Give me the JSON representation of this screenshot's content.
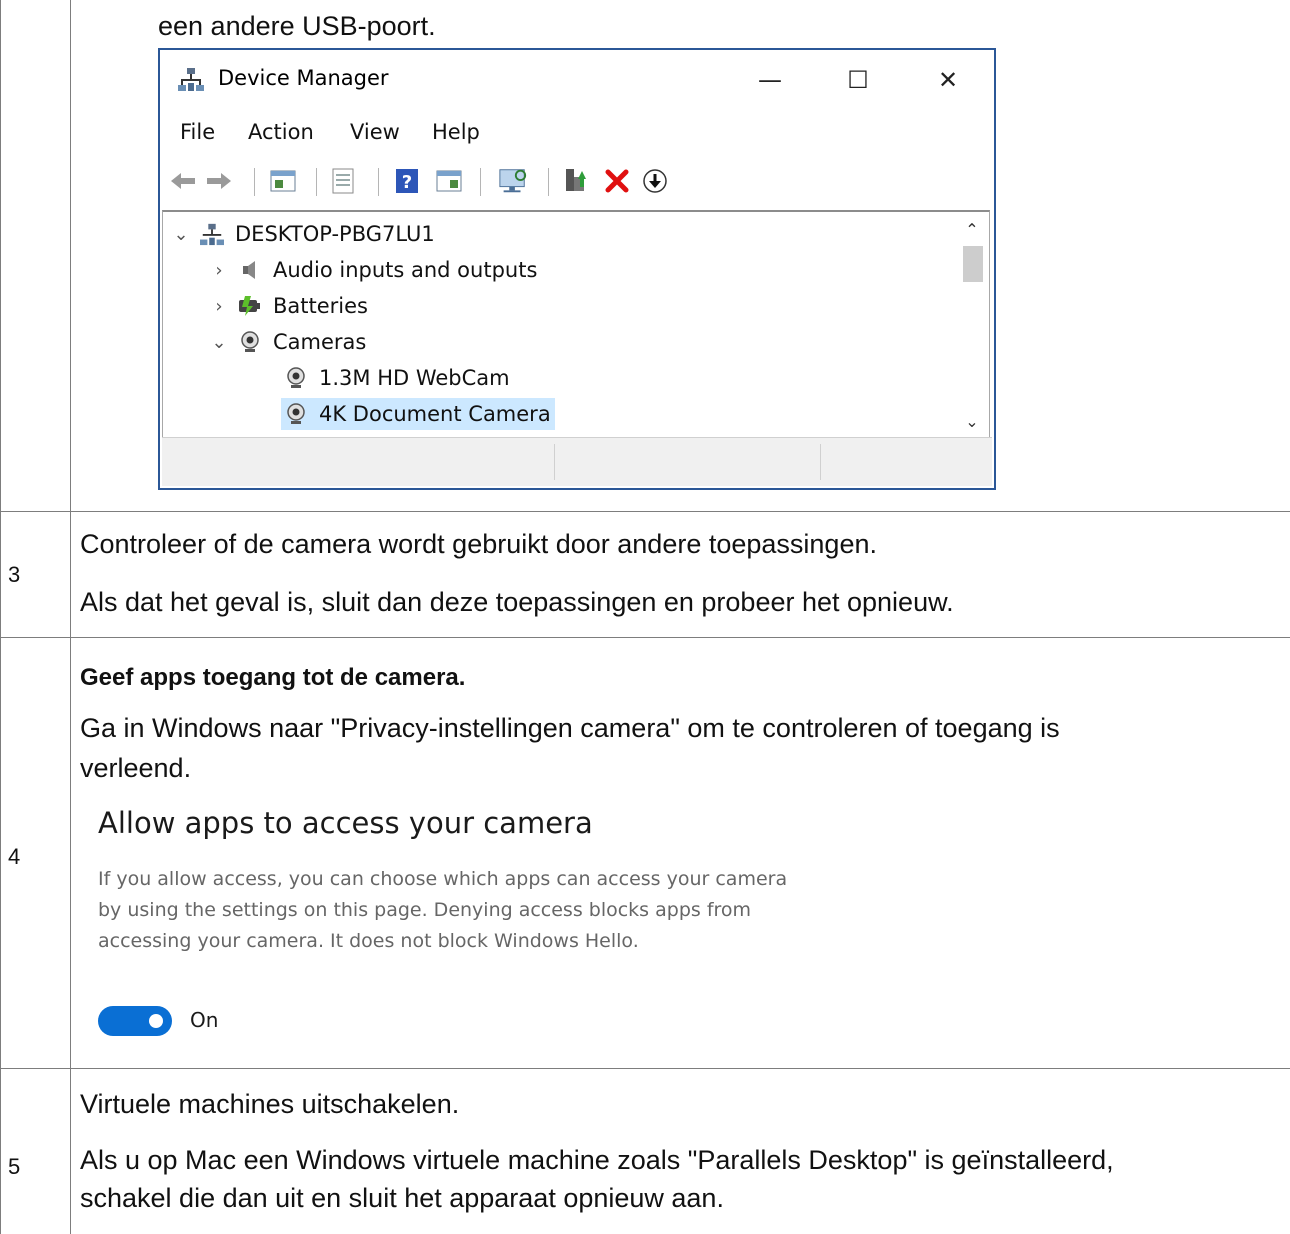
{
  "row2": {
    "text_tail": "een andere USB-poort."
  },
  "device_manager": {
    "title": "Device Manager",
    "window_controls": {
      "minimize": "—",
      "maximize": "☐",
      "close": "✕"
    },
    "menu": [
      "File",
      "Action",
      "View",
      "Help"
    ],
    "toolbar_icons": [
      "back-icon",
      "forward-icon",
      "properties-icon",
      "update-icon",
      "help-icon",
      "view-icon",
      "scan-hardware-icon",
      "add-driver-icon",
      "uninstall-icon",
      "download-icon"
    ],
    "tree": {
      "root": "DESKTOP-PBG7LU1",
      "items": [
        {
          "label": "Audio inputs and outputs",
          "expanded": false
        },
        {
          "label": "Batteries",
          "expanded": false
        },
        {
          "label": "Cameras",
          "expanded": true
        }
      ],
      "children": [
        {
          "label": "1.3M HD WebCam",
          "selected": false
        },
        {
          "label": "4K Document Camera",
          "selected": true
        }
      ]
    }
  },
  "row3": {
    "number": "3",
    "line1": "Controleer of de camera wordt gebruikt door andere toepassingen.",
    "line2": "Als dat het geval is, sluit dan deze toepassingen en probeer het opnieuw."
  },
  "row4": {
    "number": "4",
    "heading": "Geef apps toegang tot de camera.",
    "line1": "Ga in Windows naar \"Privacy-instellingen camera\" om te controleren of toegang is",
    "line2": "verleend.",
    "settings": {
      "title": "Allow apps to access your camera",
      "desc_line1": "If you allow access, you can choose which apps can access your camera",
      "desc_line2": "by using the settings on this page. Denying access blocks apps from",
      "desc_line3": "accessing your camera. It does not block Windows Hello.",
      "toggle_state": "On",
      "toggle_color": "#0a6fd4"
    }
  },
  "row5": {
    "number": "5",
    "line1": "Virtuele machines uitschakelen.",
    "line2": "Als u op Mac een Windows virtuele machine zoals \"Parallels Desktop\" is geïnstalleerd,",
    "line3": "schakel die dan uit en sluit het apparaat opnieuw aan."
  }
}
